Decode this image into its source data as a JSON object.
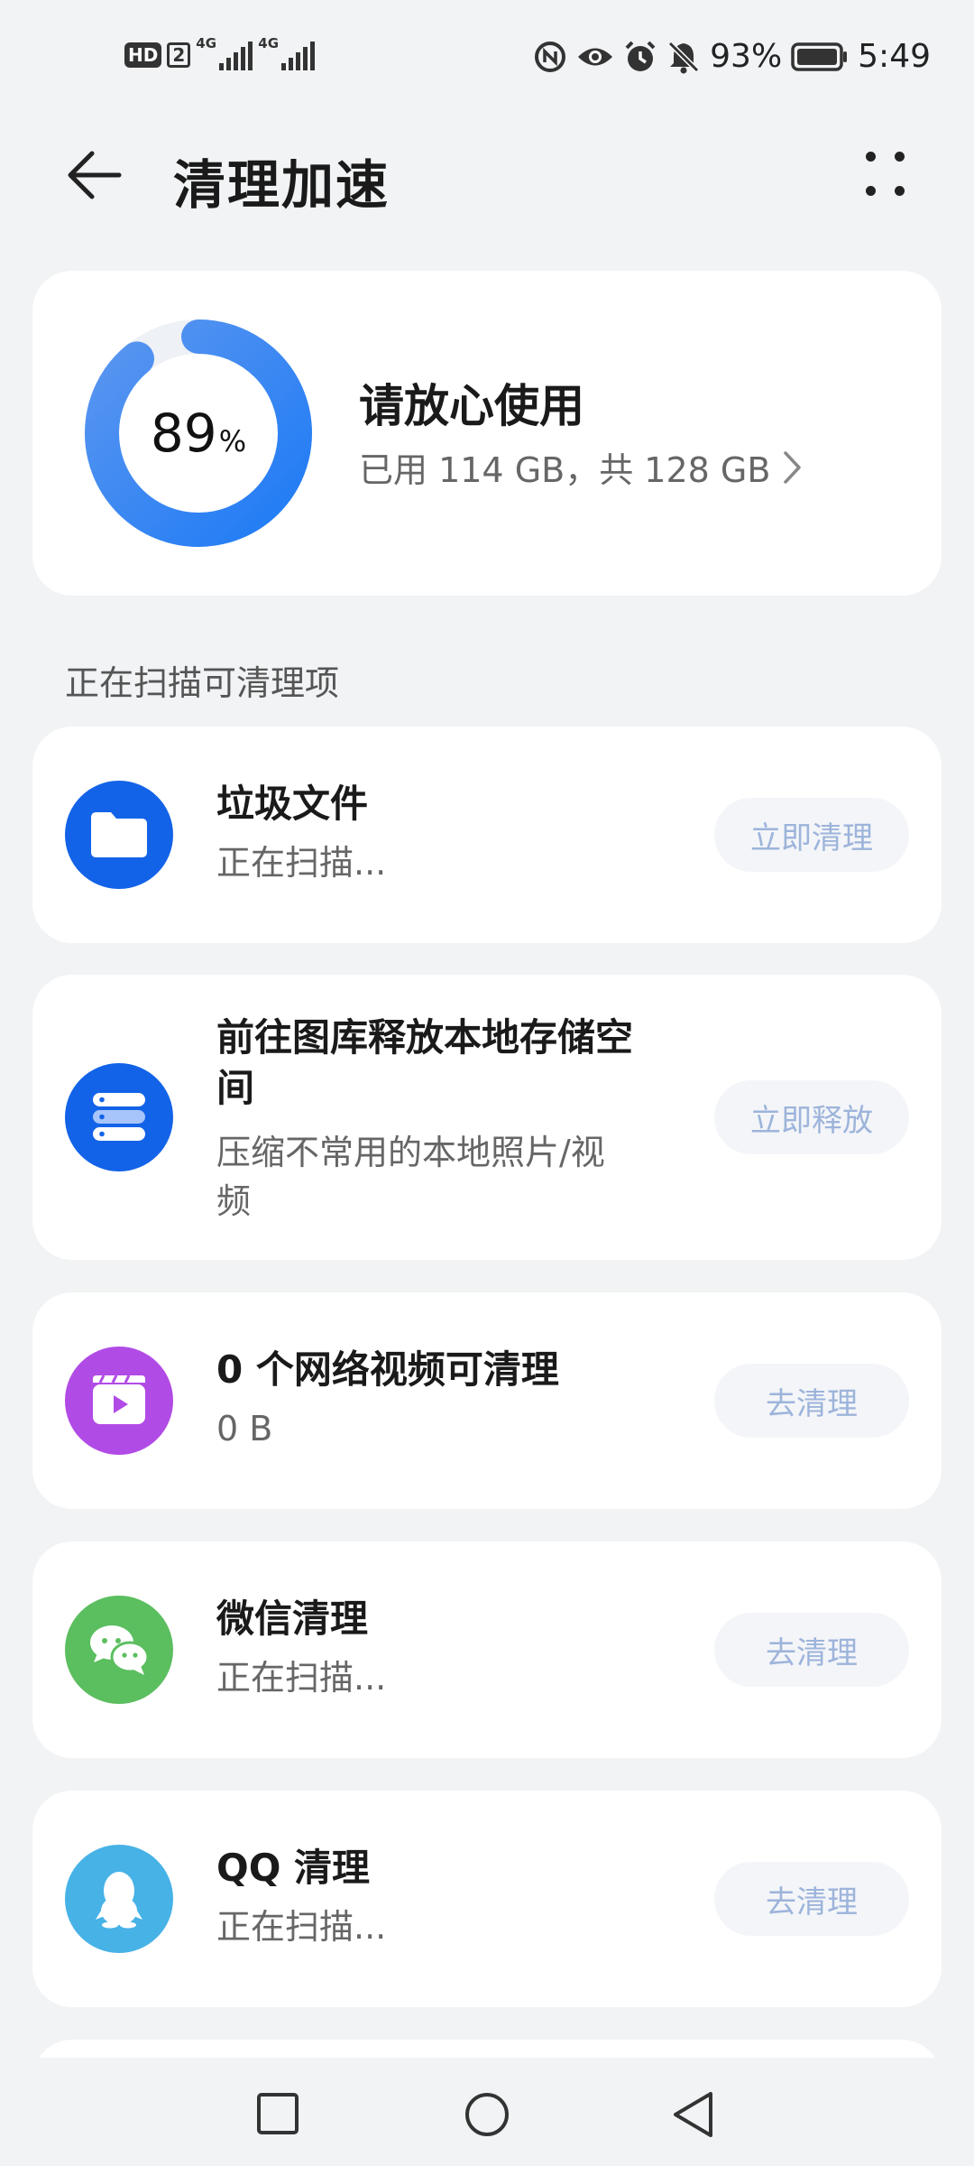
{
  "status_bar": {
    "hd_label": "HD",
    "sim_label": "2",
    "net1": "4G",
    "net2": "4G",
    "battery": "93%",
    "time": "5:49"
  },
  "header": {
    "title": "清理加速"
  },
  "storage": {
    "percent": "89",
    "percent_sign": "%",
    "percent_value": 89,
    "status": "请放心使用",
    "usage": "已用 114 GB，共 128 GB",
    "ring_start_color": "#1F7BF5",
    "ring_end_color": "#5A96F0"
  },
  "section_title": "正在扫描可清理项",
  "items": [
    {
      "title": "垃圾文件",
      "subtitle": "正在扫描...",
      "button": "立即清理",
      "icon": "folder-icon",
      "color": "#1363E8"
    },
    {
      "title_line1": "前往图库释放本地存储空",
      "title_line2": "间",
      "subtitle_line1": "压缩不常用的本地照片/视",
      "subtitle_line2": "频",
      "button": "立即释放",
      "icon": "storage-icon",
      "color": "#1363E8"
    },
    {
      "title": "0 个网络视频可清理",
      "subtitle": "0 B",
      "button": "去清理",
      "icon": "video-icon",
      "color": "#B14BE6"
    },
    {
      "title": "微信清理",
      "subtitle": "正在扫描...",
      "button": "去清理",
      "icon": "wechat-icon",
      "color": "#5BBE5F"
    },
    {
      "title": "QQ 清理",
      "subtitle": "正在扫描...",
      "button": "去清理",
      "icon": "qq-icon",
      "color": "#47B2E6"
    }
  ]
}
